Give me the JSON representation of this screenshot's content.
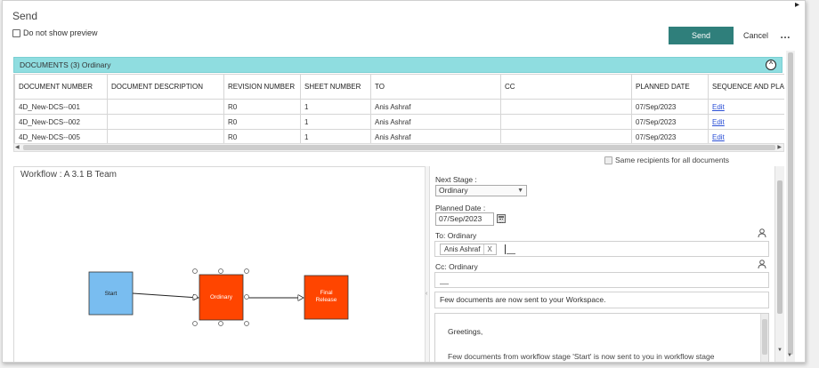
{
  "dialog": {
    "title": "Send",
    "preview_checkbox_label": "Do not show preview",
    "send_label": "Send",
    "cancel_label": "Cancel",
    "more_label": "…"
  },
  "documents": {
    "header_label": "DOCUMENTS (3) Ordinary",
    "collapse_glyph": "^",
    "columns": [
      "DOCUMENT NUMBER",
      "DOCUMENT DESCRIPTION",
      "REVISION NUMBER",
      "SHEET NUMBER",
      "TO",
      "CC",
      "PLANNED DATE",
      "SEQUENCE AND PLA..."
    ],
    "rows": [
      [
        "4D_New-DCS--001",
        "",
        "R0",
        "1",
        "Anis Ashraf",
        "",
        "07/Sep/2023",
        "Edit"
      ],
      [
        "4D_New-DCS--002",
        "",
        "R0",
        "1",
        "Anis Ashraf",
        "",
        "07/Sep/2023",
        "Edit"
      ],
      [
        "4D_New-DCS--005",
        "",
        "R0",
        "1",
        "Anis Ashraf",
        "",
        "07/Sep/2023",
        "Edit"
      ]
    ],
    "same_recipients_label": "Same recipients for all documents"
  },
  "workflow": {
    "title": "Workflow : A 3.1 B Team",
    "nodes": [
      {
        "label": "Start",
        "color": "#79bdf0"
      },
      {
        "label": "Ordinary",
        "color": "#ff4500"
      },
      {
        "label": "Final Release",
        "color": "#ff4500"
      }
    ]
  },
  "form": {
    "next_stage_label": "Next Stage :",
    "next_stage_value": "Ordinary",
    "planned_date_label": "Planned Date :",
    "planned_date_value": "07/Sep/2023",
    "to_label": "To: Ordinary",
    "to_chip": "Anis Ashraf",
    "to_chip_remove": "X",
    "cc_label": "Cc: Ordinary",
    "subject": "Few documents are now sent to your Workspace.",
    "body_greeting": "Greetings,",
    "body_text": "Few documents from workflow stage 'Start' is now sent to you in workflow stage"
  },
  "colors": {
    "accent": "#2f7f7b",
    "header_bg": "#8fdde0",
    "link": "#2a4fd6"
  }
}
